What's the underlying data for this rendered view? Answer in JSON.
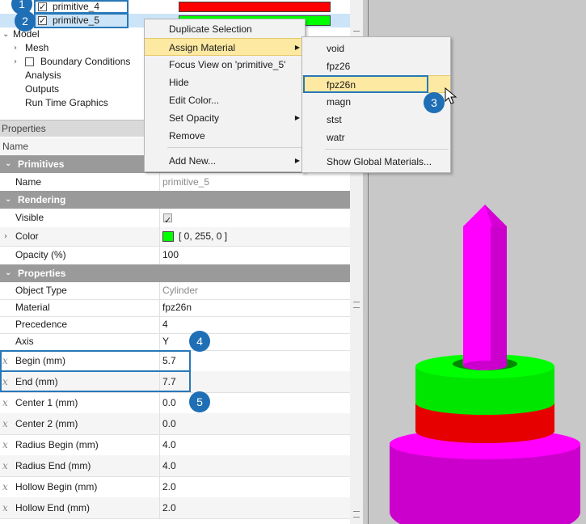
{
  "tree": {
    "items": [
      {
        "label": "primitive_4",
        "color": "#ff0000"
      },
      {
        "label": "primitive_5",
        "color": "#00ff00"
      }
    ],
    "model_label": "Model",
    "mesh_label": "Mesh",
    "boundary_label": "Boundary Conditions",
    "analysis_label": "Analysis",
    "outputs_label": "Outputs",
    "rtg_label": "Run Time Graphics"
  },
  "properties": {
    "panel_title": "Properties",
    "col_name": "Name",
    "sections": {
      "primitives": "Primitives",
      "rendering": "Rendering",
      "properties": "Properties"
    },
    "rows": {
      "name": {
        "label": "Name",
        "value": "primitive_5"
      },
      "visible": {
        "label": "Visible"
      },
      "color": {
        "label": "Color",
        "value": "[ 0, 255, 0 ]",
        "swatch": "#00ff00"
      },
      "opacity": {
        "label": "Opacity (%)",
        "value": "100"
      },
      "object_type": {
        "label": "Object Type",
        "value": "Cylinder"
      },
      "material": {
        "label": "Material",
        "value": "fpz26n"
      },
      "precedence": {
        "label": "Precedence",
        "value": "4"
      },
      "axis": {
        "label": "Axis",
        "value": "Y"
      },
      "begin": {
        "label": "Begin (mm)",
        "value": "5.7"
      },
      "end": {
        "label": "End (mm)",
        "value": "7.7"
      },
      "center1": {
        "label": "Center 1 (mm)",
        "value": "0.0"
      },
      "center2": {
        "label": "Center 2 (mm)",
        "value": "0.0"
      },
      "radius_begin": {
        "label": "Radius Begin (mm)",
        "value": "4.0"
      },
      "radius_end": {
        "label": "Radius End (mm)",
        "value": "4.0"
      },
      "hollow_begin": {
        "label": "Hollow Begin (mm)",
        "value": "2.0"
      },
      "hollow_end": {
        "label": "Hollow End (mm)",
        "value": "2.0"
      }
    }
  },
  "context_menu": {
    "items": [
      "Duplicate Selection",
      "Assign Material",
      "Focus View on 'primitive_5'",
      "Hide",
      "Edit Color...",
      "Set Opacity",
      "Remove",
      "Add New..."
    ]
  },
  "material_menu": {
    "items": [
      "void",
      "fpz26",
      "fpz26n",
      "magn",
      "stst",
      "watr"
    ],
    "footer": "Show Global Materials..."
  },
  "callouts": [
    "1",
    "2",
    "3",
    "4",
    "5"
  ],
  "colors": {
    "accent": "#1e6fb5",
    "section_header": "#9a9a9a",
    "menu_highlight": "#fde9a2"
  }
}
